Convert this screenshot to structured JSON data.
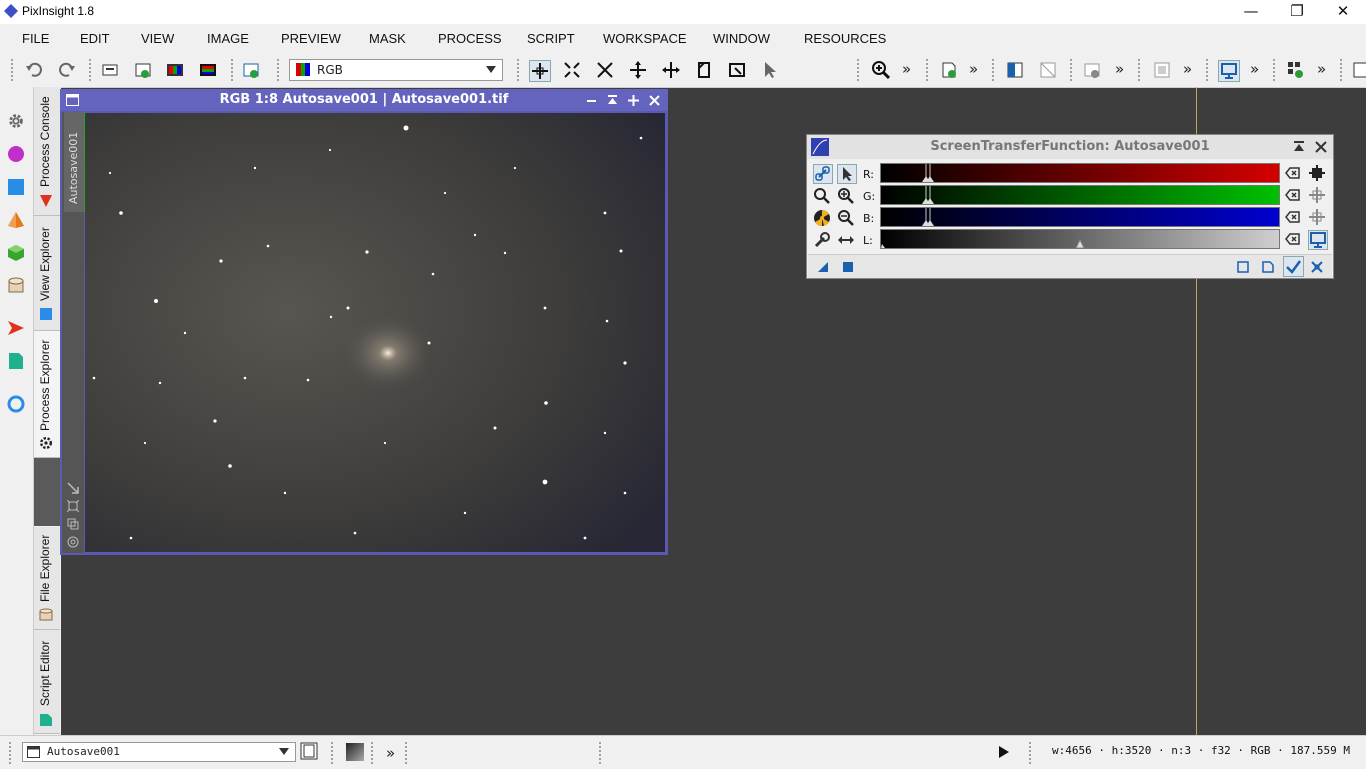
{
  "app": {
    "title": "PixInsight 1.8"
  },
  "window_controls": {
    "minimize": "—",
    "maximize": "❐",
    "close": "✕"
  },
  "menu": [
    "FILE",
    "EDIT",
    "VIEW",
    "IMAGE",
    "PREVIEW",
    "MASK",
    "PROCESS",
    "SCRIPT",
    "WORKSPACE",
    "WINDOW",
    "RESOURCES"
  ],
  "toolbar": {
    "view_select_value": "RGB",
    "more": "»"
  },
  "left_dock": {
    "tabs": [
      "Process Console",
      "View Explorer",
      "Process Explorer",
      "File Explorer",
      "Script Editor"
    ]
  },
  "image_window": {
    "title": "RGB 1:8 Autosave001 | Autosave001.tif",
    "side_tab": "Autosave001"
  },
  "stf": {
    "title": "ScreenTransferFunction: Autosave001",
    "channels": [
      {
        "label": "R:",
        "color": "#d40000"
      },
      {
        "label": "G:",
        "color": "#00c000"
      },
      {
        "label": "B:",
        "color": "#0000d0"
      },
      {
        "label": "L:",
        "color": "#cfcfcf"
      }
    ]
  },
  "statusbar": {
    "view": "Autosave001",
    "info": "w:4656 · h:3520 · n:3 · f32 · RGB · 187.559 M"
  },
  "colors": {
    "accent": "#6464bf",
    "workspace": "#3d3d3d"
  }
}
